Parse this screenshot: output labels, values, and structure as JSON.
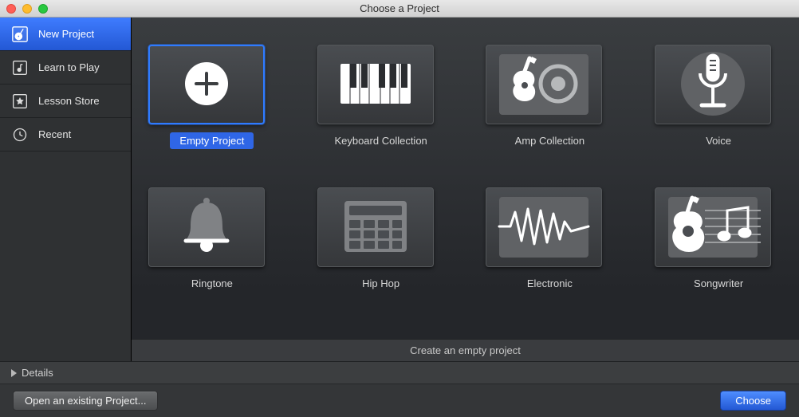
{
  "title": "Choose a Project",
  "sidebar": {
    "items": [
      {
        "label": "New Project"
      },
      {
        "label": "Learn to Play"
      },
      {
        "label": "Lesson Store"
      },
      {
        "label": "Recent"
      }
    ]
  },
  "templates": [
    {
      "label": "Empty Project"
    },
    {
      "label": "Keyboard Collection"
    },
    {
      "label": "Amp Collection"
    },
    {
      "label": "Voice"
    },
    {
      "label": "Ringtone"
    },
    {
      "label": "Hip Hop"
    },
    {
      "label": "Electronic"
    },
    {
      "label": "Songwriter"
    }
  ],
  "description": "Create an empty project",
  "details_label": "Details",
  "open_existing_label": "Open an existing Project...",
  "choose_label": "Choose"
}
